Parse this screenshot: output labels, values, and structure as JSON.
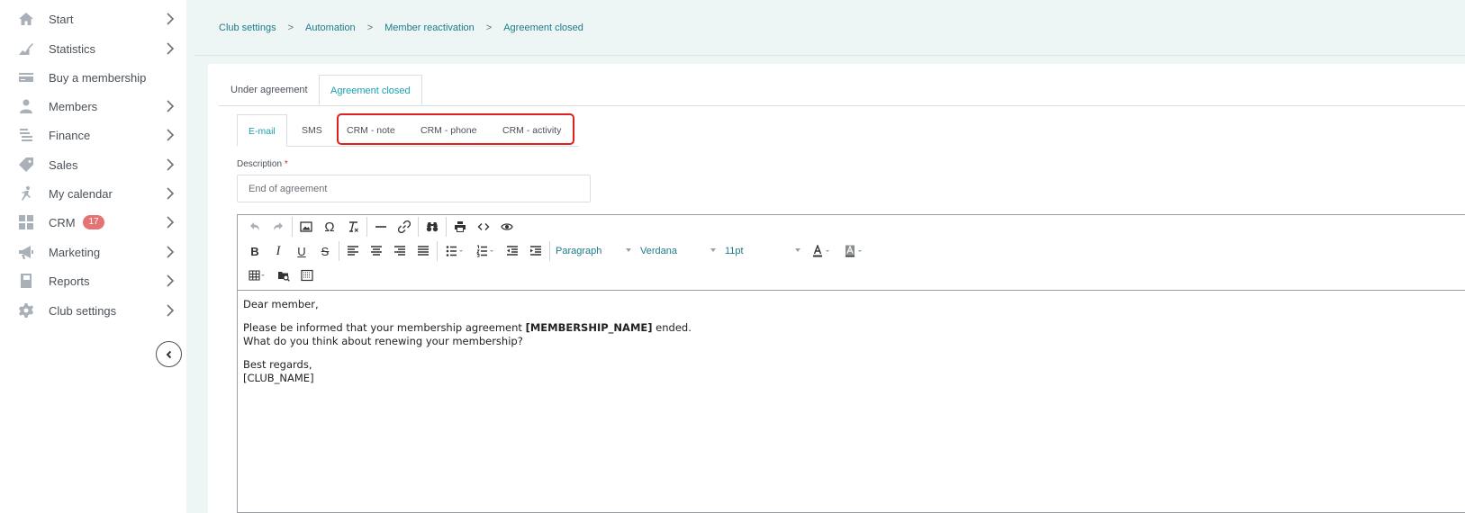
{
  "sidebar": {
    "items": [
      {
        "label": "Start",
        "icon": "home-icon"
      },
      {
        "label": "Statistics",
        "icon": "chart-icon"
      },
      {
        "label": "Buy a membership",
        "icon": "card-icon"
      },
      {
        "label": "Members",
        "icon": "person-icon"
      },
      {
        "label": "Finance",
        "icon": "finance-icon"
      },
      {
        "label": "Sales",
        "icon": "tag-icon"
      },
      {
        "label": "My calendar",
        "icon": "runner-icon"
      },
      {
        "label": "CRM",
        "icon": "grid-icon",
        "badge": "17"
      },
      {
        "label": "Marketing",
        "icon": "megaphone-icon"
      },
      {
        "label": "Reports",
        "icon": "book-icon"
      },
      {
        "label": "Club settings",
        "icon": "gear-icon"
      }
    ]
  },
  "breadcrumb": [
    "Club settings",
    "Automation",
    "Member reactivation",
    "Agreement closed"
  ],
  "top_tabs": [
    "Under agreement",
    "Agreement closed"
  ],
  "sub_tabs": [
    "E-mail",
    "SMS",
    "CRM - note",
    "CRM - phone",
    "CRM - activity"
  ],
  "description": {
    "label": "Description",
    "required_mark": "*",
    "value": "End of agreement"
  },
  "toolbar": {
    "format": "Paragraph",
    "font": "Verdana",
    "size": "11pt"
  },
  "editor": {
    "greeting": "Dear member,",
    "line1_before": "Please be informed that your membership agreement ",
    "line1_bold": "[MEMBERSHIP_NAME]",
    "line1_after": " ended.",
    "line2": "What do you think about renewing your membership?",
    "signoff": "Best regards,",
    "club": "[CLUB_NAME]"
  },
  "colors": {
    "accent": "#1ba1b0",
    "highlight": "#e0201e",
    "badge": "#e57373"
  }
}
